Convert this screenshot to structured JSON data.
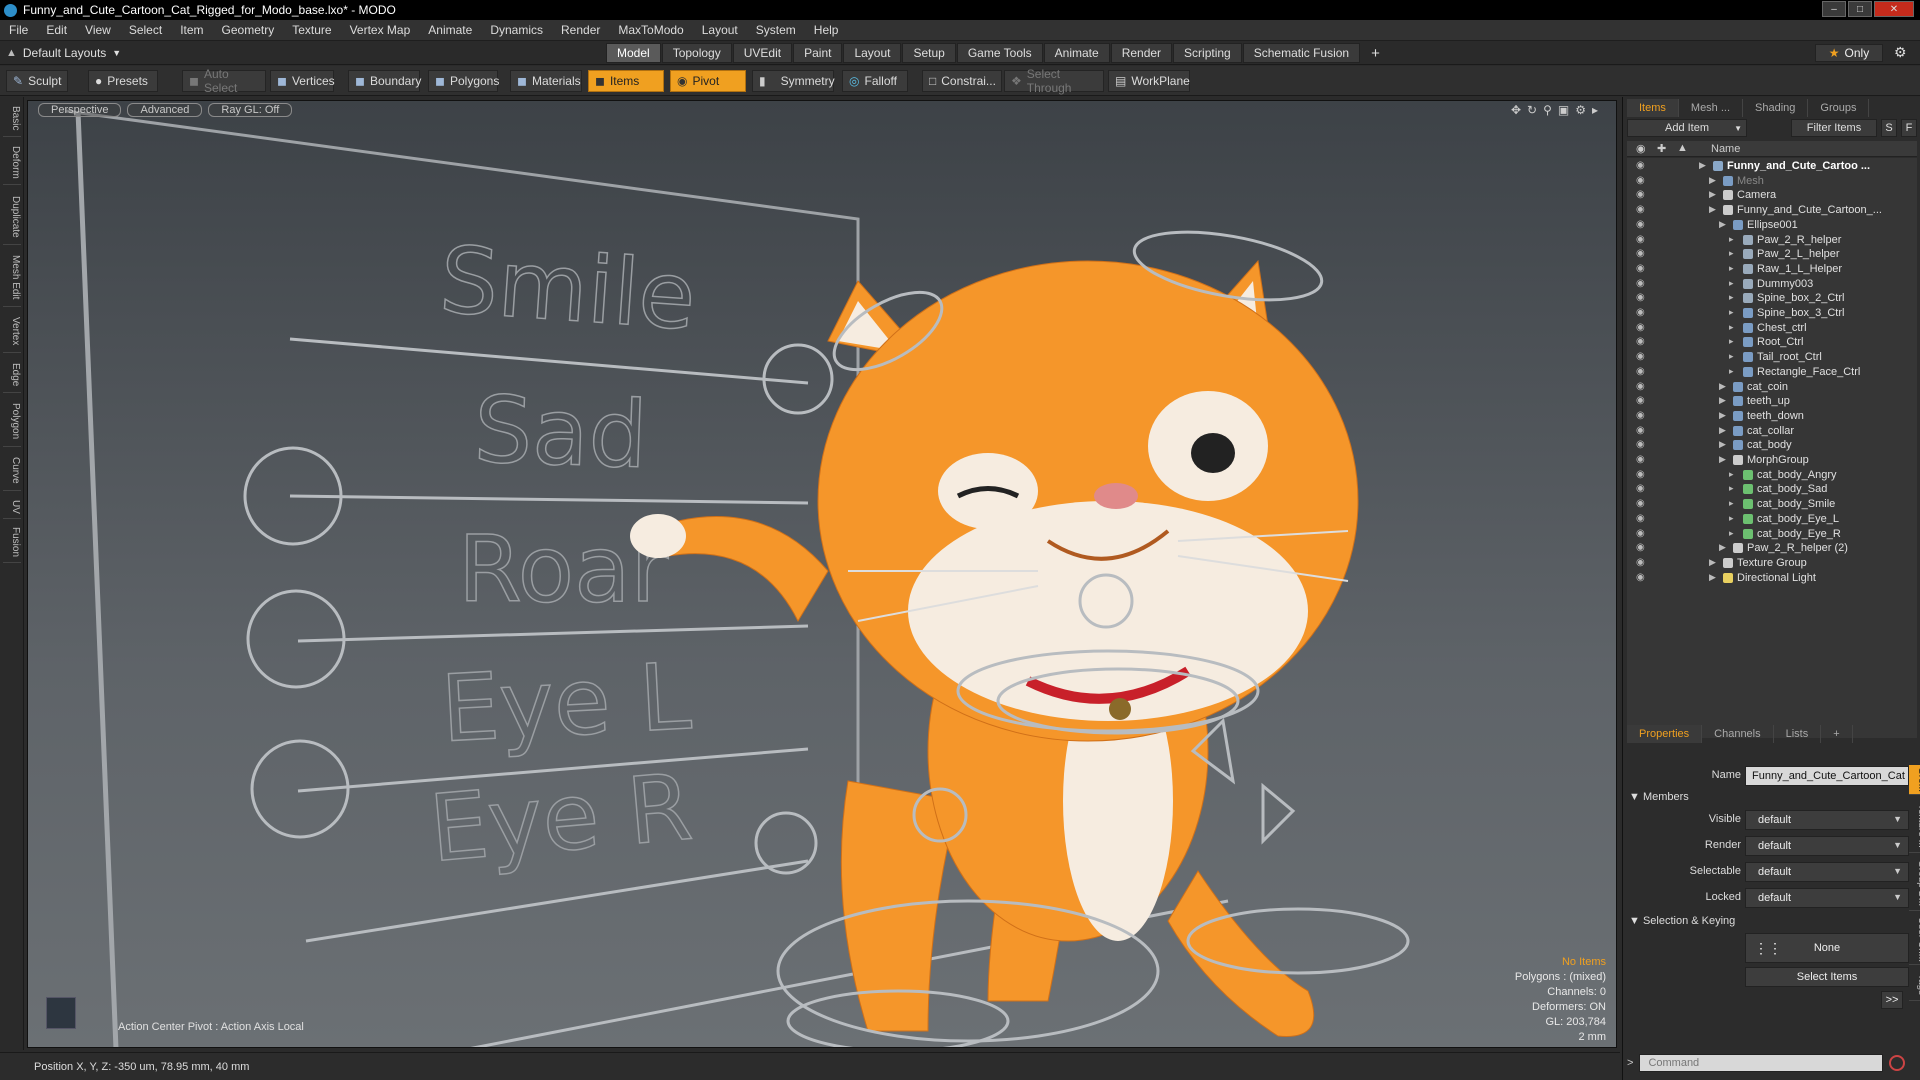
{
  "window": {
    "title": "Funny_and_Cute_Cartoon_Cat_Rigged_for_Modo_base.lxo* - MODO"
  },
  "menu": [
    "File",
    "Edit",
    "View",
    "Select",
    "Item",
    "Geometry",
    "Texture",
    "Vertex Map",
    "Animate",
    "Dynamics",
    "Render",
    "MaxToModo",
    "Layout",
    "System",
    "Help"
  ],
  "modebar": {
    "layout": "Default Layouts",
    "tabs": [
      "Model",
      "Topology",
      "UVEdit",
      "Paint",
      "Layout",
      "Setup",
      "Game Tools",
      "Animate",
      "Render",
      "Scripting",
      "Schematic Fusion"
    ],
    "active_tab": "Model",
    "plus": "+",
    "only": "Only"
  },
  "toolbar": {
    "sculpt": "Sculpt",
    "presets": "Presets",
    "auto_select": "Auto Select",
    "vertices": "Vertices",
    "boundary": "Boundary",
    "polygons": "Polygons",
    "materials": "Materials",
    "items": "Items",
    "pivot": "Pivot",
    "symmetry": "Symmetry",
    "falloff": "Falloff",
    "constrain": "Constrai...",
    "select_through": "Select Through",
    "workplane": "WorkPlane"
  },
  "left_tabs": [
    "Basic",
    "Deform",
    "Duplicate",
    "Mesh Edit",
    "Vertex",
    "Edge",
    "Polygon",
    "Curve",
    "UV",
    "Fusion"
  ],
  "viewport": {
    "view": "Perspective",
    "shading": "Advanced",
    "raygl": "Ray GL: Off",
    "face_labels": [
      "Smile",
      "Sad",
      "Roar",
      "Eye L",
      "Eye R"
    ],
    "action_center": "Action Center Pivot : Action Axis Local",
    "info": {
      "no_items": "No Items",
      "polygons": "Polygons : (mixed)",
      "channels": "Channels: 0",
      "deformers": "Deformers: ON",
      "gl": "GL: 203,784",
      "scale": "2 mm"
    }
  },
  "status": {
    "position": "Position X, Y, Z:  -350 um, 78.95 mm, 40 mm"
  },
  "items_panel": {
    "tabs": [
      "Items",
      "Mesh ...",
      "Shading",
      "Groups"
    ],
    "add_item": "Add Item",
    "filter": "Filter Items",
    "s": "S",
    "f": "F",
    "name_header": "Name",
    "tree": [
      {
        "label": "Funny_and_Cute_Cartoo ...",
        "level": 0,
        "bold": true,
        "icon": "scene"
      },
      {
        "label": "Mesh",
        "level": 1,
        "dim": true,
        "icon": "mesh"
      },
      {
        "label": "Camera",
        "level": 1,
        "icon": "camera"
      },
      {
        "label": "Funny_and_Cute_Cartoon_...",
        "level": 1,
        "icon": "group"
      },
      {
        "label": "Ellipse001",
        "level": 2,
        "icon": "mesh"
      },
      {
        "label": "Paw_2_R_helper",
        "level": 3,
        "icon": "locator"
      },
      {
        "label": "Paw_2_L_helper",
        "level": 3,
        "icon": "locator"
      },
      {
        "label": "Raw_1_L_Helper",
        "level": 3,
        "icon": "locator"
      },
      {
        "label": "Dummy003",
        "level": 3,
        "icon": "locator"
      },
      {
        "label": "Spine_box_2_Ctrl",
        "level": 3,
        "icon": "locator"
      },
      {
        "label": "Spine_box_3_Ctrl",
        "level": 3,
        "icon": "mesh"
      },
      {
        "label": "Chest_ctrl",
        "level": 3,
        "icon": "mesh"
      },
      {
        "label": "Root_Ctrl",
        "level": 3,
        "icon": "mesh"
      },
      {
        "label": "Tail_root_Ctrl",
        "level": 3,
        "icon": "mesh"
      },
      {
        "label": "Rectangle_Face_Ctrl",
        "level": 3,
        "icon": "mesh"
      },
      {
        "label": "cat_coin",
        "level": 2,
        "icon": "mesh"
      },
      {
        "label": "teeth_up",
        "level": 2,
        "icon": "mesh"
      },
      {
        "label": "teeth_down",
        "level": 2,
        "icon": "mesh"
      },
      {
        "label": "cat_collar",
        "level": 2,
        "icon": "mesh"
      },
      {
        "label": "cat_body",
        "level": 2,
        "icon": "mesh"
      },
      {
        "label": "MorphGroup",
        "level": 2,
        "icon": "group"
      },
      {
        "label": "cat_body_Angry",
        "level": 3,
        "icon": "morph"
      },
      {
        "label": "cat_body_Sad",
        "level": 3,
        "icon": "morph"
      },
      {
        "label": "cat_body_Smile",
        "level": 3,
        "icon": "morph"
      },
      {
        "label": "cat_body_Eye_L",
        "level": 3,
        "icon": "morph"
      },
      {
        "label": "cat_body_Eye_R",
        "level": 3,
        "icon": "morph"
      },
      {
        "label": "Paw_2_R_helper (2)",
        "level": 2,
        "icon": "group"
      },
      {
        "label": "Texture Group",
        "level": 1,
        "icon": "group"
      },
      {
        "label": "Directional Light",
        "level": 1,
        "icon": "light"
      }
    ]
  },
  "properties_panel": {
    "tabs": [
      "Properties",
      "Channels",
      "Lists",
      "+"
    ],
    "name_label": "Name",
    "name_value": "Funny_and_Cute_Cartoon_Cat",
    "members": "Members",
    "fields": [
      {
        "label": "Visible",
        "value": "default"
      },
      {
        "label": "Render",
        "value": "default"
      },
      {
        "label": "Selectable",
        "value": "default"
      },
      {
        "label": "Locked",
        "value": "default"
      }
    ],
    "selection_keying": "Selection & Keying",
    "none": "None",
    "select_items": "Select Items",
    "more": ">>",
    "side_tabs": [
      "Gro...",
      "Texture ...",
      "Group D...",
      "User Ch...",
      "Tags"
    ]
  },
  "command": {
    "prompt": ">",
    "placeholder": "Command"
  },
  "colors": {
    "accent": "#f0a020",
    "cat": "#f5962a"
  }
}
